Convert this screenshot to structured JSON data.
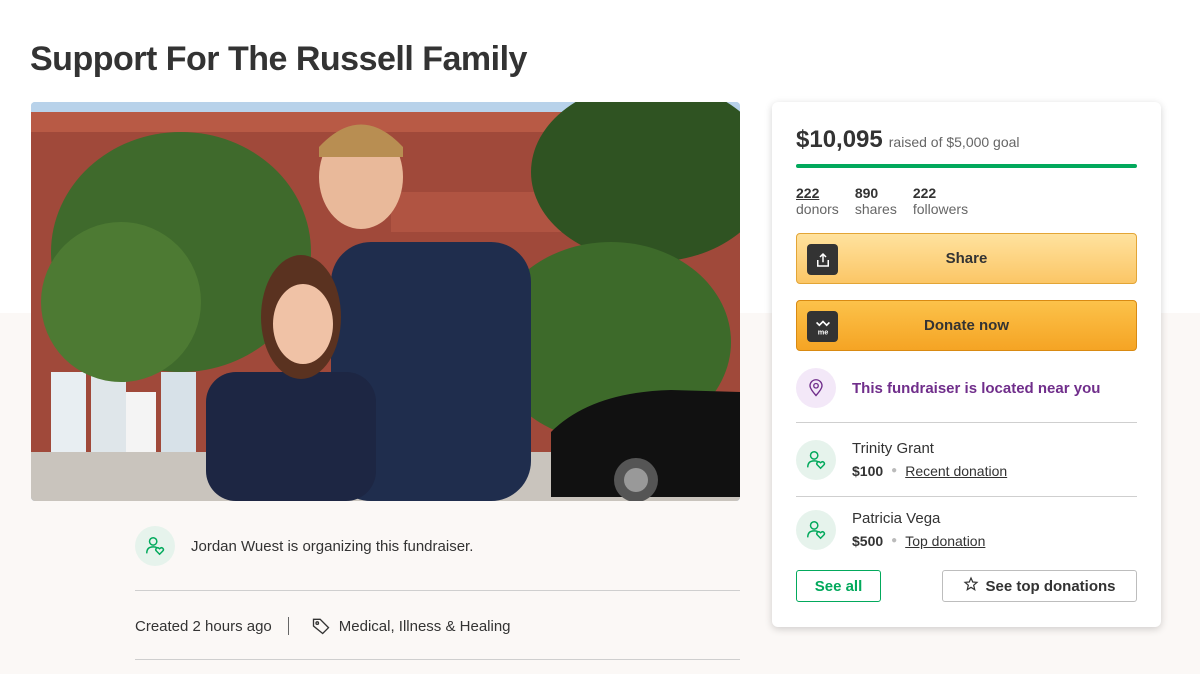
{
  "page": {
    "title": "Support For The Russell Family"
  },
  "hero": {
    "alt": "Photo of a smiling couple standing in front of a brick building"
  },
  "organizer": {
    "text": "Jordan Wuest is organizing this fundraiser."
  },
  "meta": {
    "created": "Created 2 hours ago",
    "category": "Medical, Illness & Healing"
  },
  "card": {
    "raised_amount": "$10,095",
    "raised_goal": "raised of $5,000 goal",
    "progress_fraction": 1.0,
    "stats": [
      {
        "num": "222",
        "label": "donors"
      },
      {
        "num": "890",
        "label": "shares"
      },
      {
        "num": "222",
        "label": "followers"
      }
    ],
    "share_label": "Share",
    "donate_label": "Donate now",
    "donate_badge": "me",
    "near_text": "This fundraiser is located near you",
    "donations": [
      {
        "name": "Trinity Grant",
        "amount": "$100",
        "kind": "Recent donation"
      },
      {
        "name": "Patricia Vega",
        "amount": "$500",
        "kind": "Top donation"
      }
    ],
    "see_all_label": "See all",
    "see_top_label": "See top donations"
  },
  "colors": {
    "accent_green": "#02a95c",
    "purple": "#702e8b",
    "donate_orange": "#f5a424"
  },
  "icons": [
    "share-icon",
    "gofundme-icon",
    "location-pin-icon",
    "donor-heart-icon",
    "tag-icon",
    "star-icon"
  ]
}
